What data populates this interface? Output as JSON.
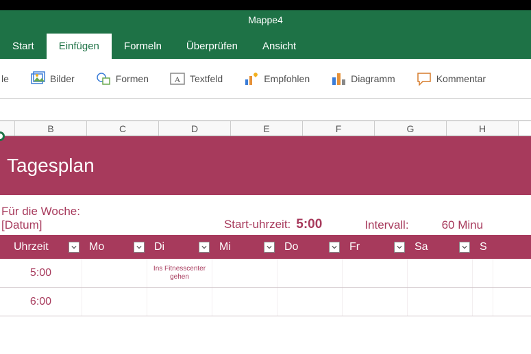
{
  "title": "Mappe4",
  "tabs": [
    {
      "label": "Start",
      "active": false
    },
    {
      "label": "Einfügen",
      "active": true
    },
    {
      "label": "Formeln",
      "active": false
    },
    {
      "label": "Überprüfen",
      "active": false
    },
    {
      "label": "Ansicht",
      "active": false
    }
  ],
  "ribbon": {
    "table_trunc": "le",
    "pictures": "Bilder",
    "shapes": "Formen",
    "textbox": "Textfeld",
    "recommended": "Empfohlen",
    "chart": "Diagramm",
    "comment": "Kommentar"
  },
  "columns": [
    "B",
    "C",
    "D",
    "E",
    "F",
    "G",
    "H"
  ],
  "plan": {
    "title": "Tagesplan",
    "week_label": "Für die Woche:",
    "week_value": "[Datum]",
    "start_label": "Start-uhrzeit:",
    "start_value": "5:00",
    "interval_label": "Intervall:",
    "interval_value": "60 Minu"
  },
  "table_headers": [
    "Uhrzeit",
    "Mo",
    "Di",
    "Mi",
    "Do",
    "Fr",
    "Sa",
    "S"
  ],
  "rows": [
    {
      "time": "5:00",
      "cells": [
        "",
        "Ins Fitnesscenter gehen",
        "",
        "",
        "",
        "",
        ""
      ]
    },
    {
      "time": "6:00",
      "cells": [
        "",
        "",
        "",
        "",
        "",
        "",
        ""
      ]
    }
  ]
}
